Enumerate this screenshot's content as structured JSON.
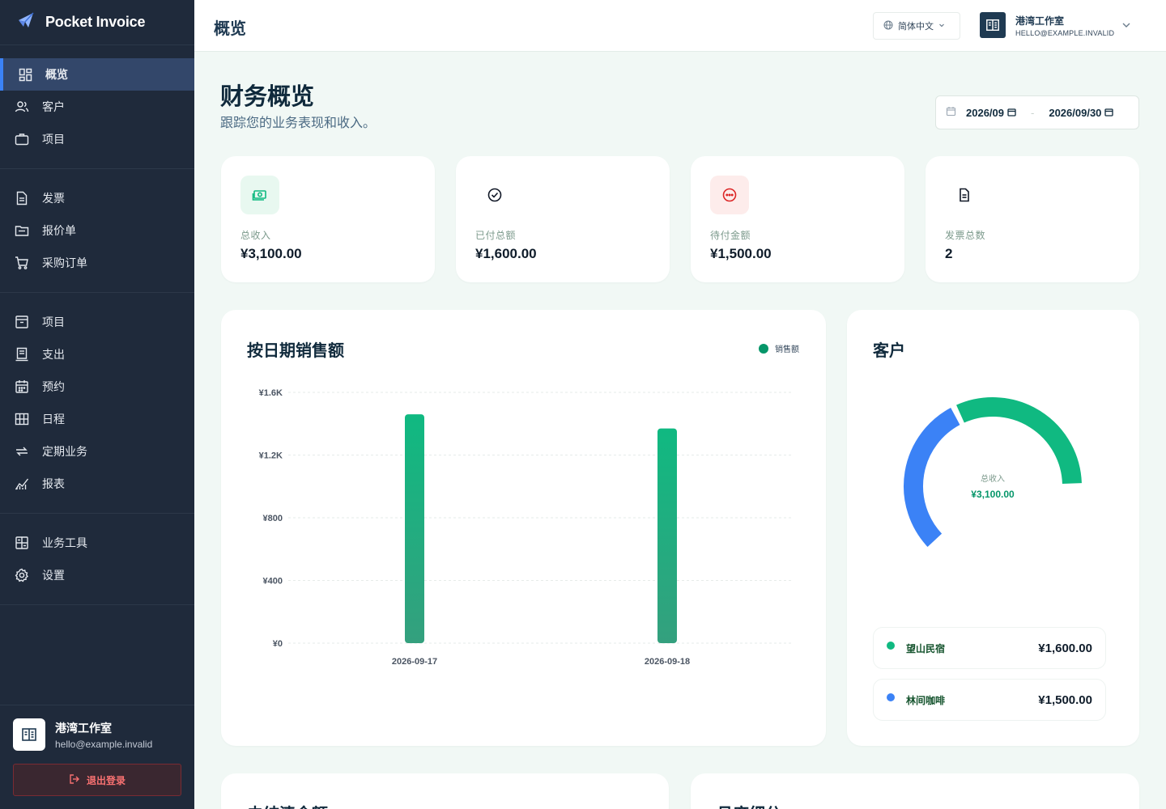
{
  "app": {
    "name": "Pocket Invoice"
  },
  "sidebar": {
    "groups": [
      [
        {
          "label": "概览",
          "icon": "dashboard-icon",
          "active": true
        },
        {
          "label": "客户",
          "icon": "users-icon"
        },
        {
          "label": "项目",
          "icon": "briefcase-icon"
        }
      ],
      [
        {
          "label": "发票",
          "icon": "document-icon"
        },
        {
          "label": "报价单",
          "icon": "folder-icon"
        },
        {
          "label": "采购订单",
          "icon": "cart-icon"
        }
      ],
      [
        {
          "label": "项目",
          "icon": "archive-icon"
        },
        {
          "label": "支出",
          "icon": "receipt-icon"
        },
        {
          "label": "预约",
          "icon": "calendar-icon"
        },
        {
          "label": "日程",
          "icon": "grid-icon"
        },
        {
          "label": "定期业务",
          "icon": "repeat-icon"
        },
        {
          "label": "报表",
          "icon": "chart-icon"
        }
      ],
      [
        {
          "label": "业务工具",
          "icon": "calculator-icon"
        },
        {
          "label": "设置",
          "icon": "gear-icon"
        }
      ]
    ],
    "user": {
      "name": "港湾工作室",
      "email": "hello@example.invalid"
    },
    "logout_label": "退出登录"
  },
  "header": {
    "title": "概览",
    "language": "简体中文",
    "account_name": "港湾工作室",
    "account_email": "HELLO@EXAMPLE.INVALID"
  },
  "main": {
    "title": "财务概览",
    "subtitle": "跟踪您的业务表现和收入。",
    "date_start": "2026/09",
    "date_end": "2026/09/30",
    "date_separator": "-",
    "stats": [
      {
        "label": "总收入",
        "value": "¥3,100.00",
        "icon": "cash-icon",
        "bg": "#e8f8f0",
        "color": "#10b981"
      },
      {
        "label": "已付总额",
        "value": "¥1,600.00",
        "icon": "check-circle-icon",
        "bg": "#ffffff",
        "color": "#111827"
      },
      {
        "label": "待付金额",
        "value": "¥1,500.00",
        "icon": "more-circle-icon",
        "bg": "#fdeceb",
        "color": "#dc2626"
      },
      {
        "label": "发票总数",
        "value": "2",
        "icon": "file-icon",
        "bg": "#ffffff",
        "color": "#111827"
      }
    ],
    "chart_title": "按日期销售额",
    "legend_label": "销售额",
    "customers_title": "客户",
    "donut_label": "总收入",
    "donut_value": "¥3,100.00",
    "customers": [
      {
        "name": "望山民宿",
        "value": "¥1,600.00",
        "color": "#10b981"
      },
      {
        "name": "林间咖啡",
        "value": "¥1,500.00",
        "color": "#3b82f6"
      }
    ],
    "bottom_titles": [
      "未结清金额",
      "月度细分"
    ]
  },
  "chart_data": {
    "type": "bar",
    "categories": [
      "2026-09-17",
      "2026-09-18"
    ],
    "series": [
      {
        "name": "销售额",
        "values": [
          1460,
          1370
        ]
      }
    ],
    "y_ticks": [
      "¥0",
      "¥400",
      "¥800",
      "¥1.2K",
      "¥1.6K"
    ],
    "ylim": [
      0,
      1600
    ],
    "grid": true,
    "legend_position": "top-right",
    "color": "#10b981"
  }
}
